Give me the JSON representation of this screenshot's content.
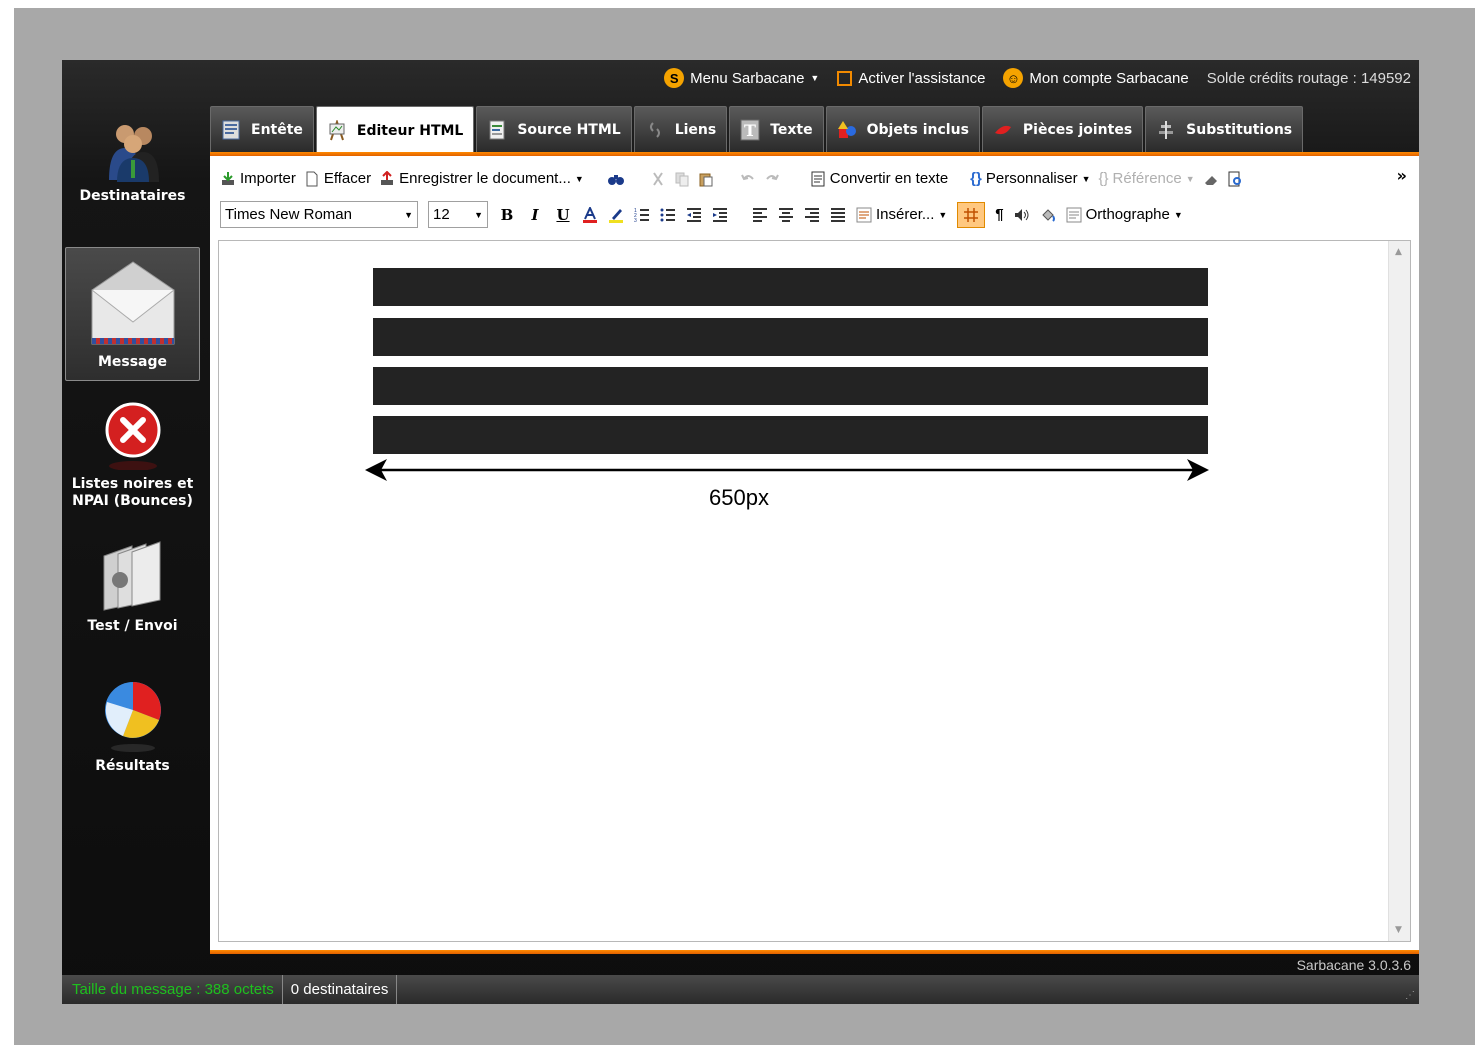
{
  "topbar": {
    "menu_label": "Menu Sarbacane",
    "assist_label": "Activer l'assistance",
    "account_label": "Mon compte Sarbacane",
    "credits_label": "Solde crédits routage : 149592"
  },
  "sidebar": {
    "items": [
      {
        "label": "Destinataires"
      },
      {
        "label": "Message"
      },
      {
        "label": "Listes noires et NPAI (Bounces)"
      },
      {
        "label": "Test / Envoi"
      },
      {
        "label": "Résultats"
      }
    ]
  },
  "tabs": [
    {
      "label": "Entête"
    },
    {
      "label": "Editeur HTML"
    },
    {
      "label": "Source HTML"
    },
    {
      "label": "Liens"
    },
    {
      "label": "Texte"
    },
    {
      "label": "Objets inclus"
    },
    {
      "label": "Pièces jointes"
    },
    {
      "label": "Substitutions"
    }
  ],
  "toolbar1": {
    "import": "Importer",
    "clear": "Effacer",
    "save_doc": "Enregistrer le document...",
    "convert": "Convertir en texte",
    "personalize": "Personnaliser",
    "reference": "Référence",
    "more": "»"
  },
  "toolbar2": {
    "font": "Times New Roman",
    "size": "12",
    "bold": "B",
    "italic": "I",
    "underline": "U",
    "insert": "Insérer...",
    "pilcrow": "¶",
    "spelling": "Orthographe"
  },
  "editor": {
    "dimension_label": "650px"
  },
  "status": {
    "message_size": "Taille du message : 388 octets",
    "recipients": "0 destinataires",
    "version": "Sarbacane 3.0.3.6"
  },
  "colors": {
    "accent_orange": "#ff8a00",
    "status_green": "#1ec01e",
    "content_bar": "#232323"
  }
}
